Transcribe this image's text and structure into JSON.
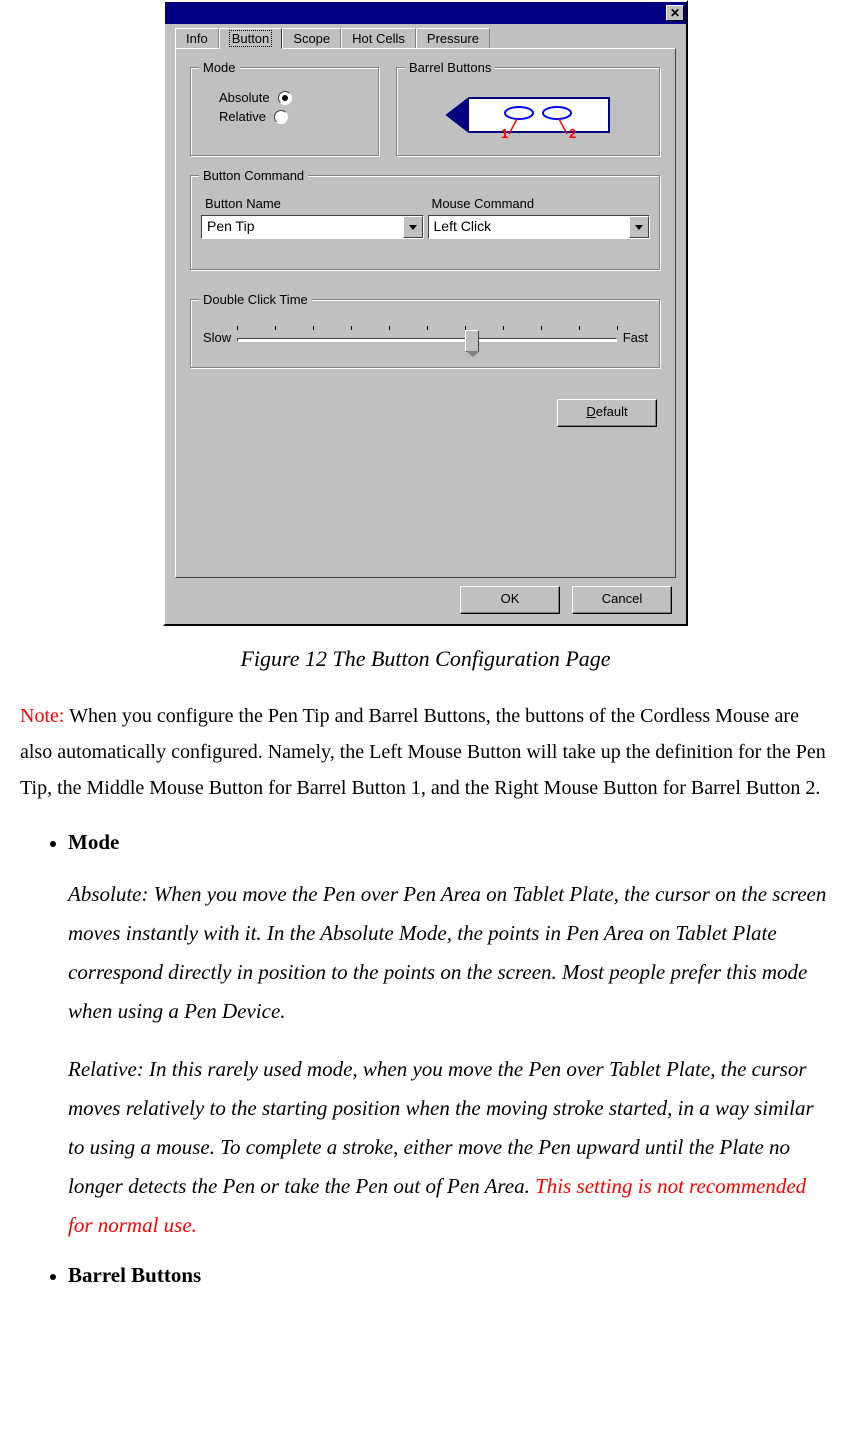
{
  "dialog": {
    "tabs": [
      "Info",
      "Button",
      "Scope",
      "Hot Cells",
      "Pressure"
    ],
    "active_tab_index": 1,
    "mode": {
      "title": "Mode",
      "absolute": "Absolute",
      "relative": "Relative",
      "selected": "Absolute"
    },
    "barrel": {
      "title": "Barrel Buttons",
      "label1": "1",
      "label2": "2"
    },
    "button_command": {
      "title": "Button Command",
      "button_name_label": "Button Name",
      "mouse_command_label": "Mouse Command",
      "button_name_value": "Pen Tip",
      "mouse_command_value": "Left Click"
    },
    "double_click": {
      "title": "Double Click Time",
      "slow": "Slow",
      "fast": "Fast"
    },
    "default_btn": "Default",
    "ok": "OK",
    "cancel": "Cancel"
  },
  "caption": "Figure 12 The Button Configuration Page",
  "note": {
    "label": "Note:",
    "text": "  When you configure the Pen Tip and Barrel Buttons, the buttons of the Cordless Mouse are also automatically configured.   Namely, the Left Mouse Button will take up the definition for the Pen Tip, the Middle Mouse Button for Barrel Button 1, and the Right Mouse Button for Barrel Button 2."
  },
  "list": {
    "mode_head": "Mode",
    "mode_abs": "Absolute: When you move the Pen over Pen Area on Tablet Plate, the cursor on the screen moves instantly with it. In the Absolute Mode, the points in Pen Area on Tablet Plate correspond directly in position to the points on the screen. Most people prefer this mode when using a Pen Device.",
    "mode_rel_main": "Relative: In this rarely used mode, when you move the Pen over Tablet Plate, the cursor moves relatively to the starting position when the moving stroke started, in a way similar to using a mouse. To complete a stroke, either move the Pen upward until the Plate no longer detects the Pen or take the Pen out of Pen Area. ",
    "mode_rel_warn": "This setting is not recommended for normal use.",
    "barrel_head": "Barrel Buttons"
  }
}
